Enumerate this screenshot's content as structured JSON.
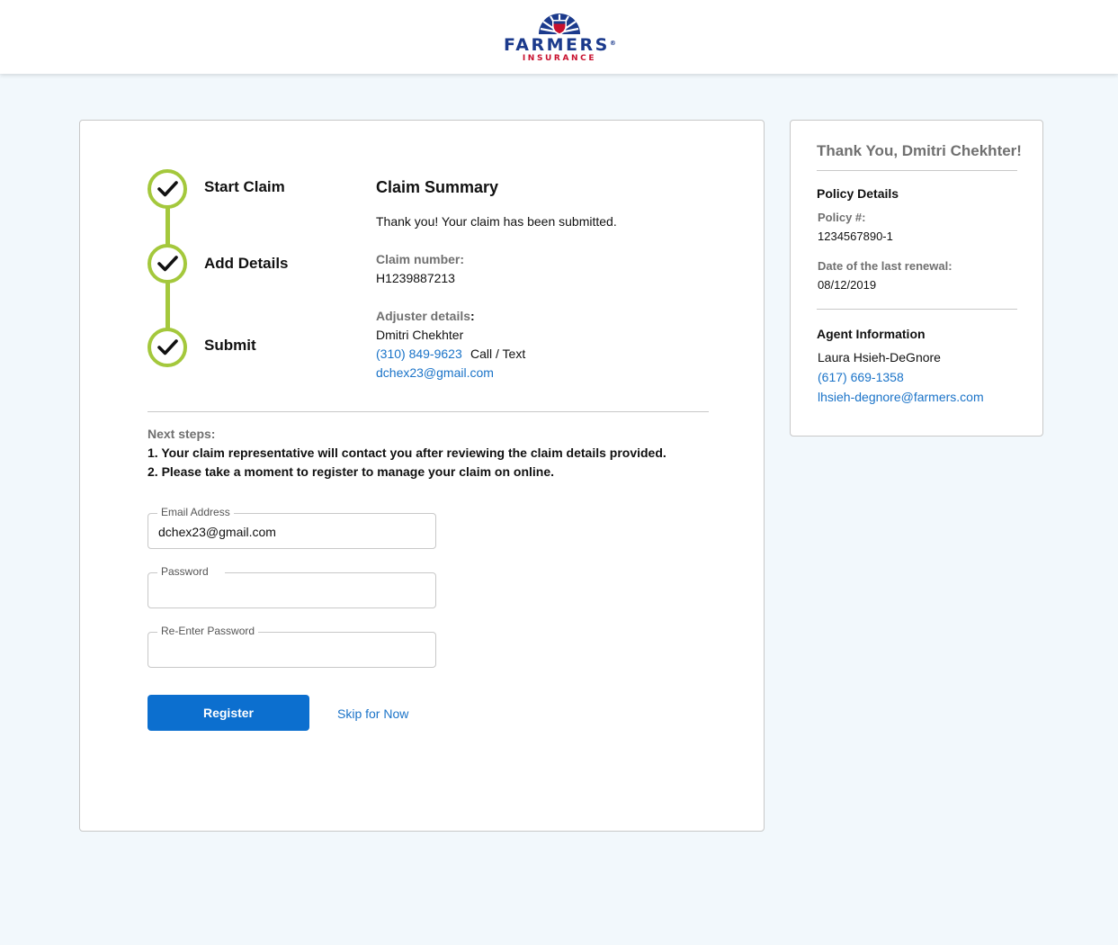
{
  "brand": {
    "name": "FARMERS",
    "registered": "®",
    "subtitle": "INSURANCE",
    "colors": {
      "navy": "#1b3a8c",
      "red": "#c8102e"
    }
  },
  "stepper": {
    "steps": [
      {
        "label": "Start Claim",
        "status": "complete"
      },
      {
        "label": "Add Details",
        "status": "complete"
      },
      {
        "label": "Submit",
        "status": "complete"
      }
    ],
    "accent_color": "#a4c83c"
  },
  "summary": {
    "title": "Claim Summary",
    "message": "Thank you! Your claim has been submitted.",
    "claim_number_label": "Claim number:",
    "claim_number": "H1239887213",
    "adjuster_label": "Adjuster details",
    "adjuster_colon": ":",
    "adjuster_name": "Dmitri Chekhter",
    "adjuster_phone": "(310) 849-9623",
    "adjuster_phone_note": "Call / Text",
    "adjuster_email": "dchex23@gmail.com"
  },
  "next_steps": {
    "title": "Next steps:",
    "items": [
      "1. Your claim representative will contact you after reviewing the claim details provided.",
      "2. Please take a moment to register to manage your claim on online."
    ]
  },
  "form": {
    "email_label": "Email Address",
    "email_value": "dchex23@gmail.com",
    "password_label": "Password",
    "reenter_label": "Re-Enter Password",
    "register_label": "Register",
    "skip_label": "Skip for Now",
    "button_color": "#0c6fcf"
  },
  "sidebar": {
    "greeting": "Thank You, Dmitri Chekhter!",
    "policy_heading": "Policy Details",
    "policy_number_label": "Policy #:",
    "policy_number": "1234567890-1",
    "renewal_label": "Date of the last renewal:",
    "renewal_date": "08/12/2019",
    "agent_heading": "Agent Information",
    "agent_name": "Laura Hsieh-DeGnore",
    "agent_phone": "(617) 669-1358",
    "agent_email": "lhsieh-degnore@farmers.com"
  }
}
